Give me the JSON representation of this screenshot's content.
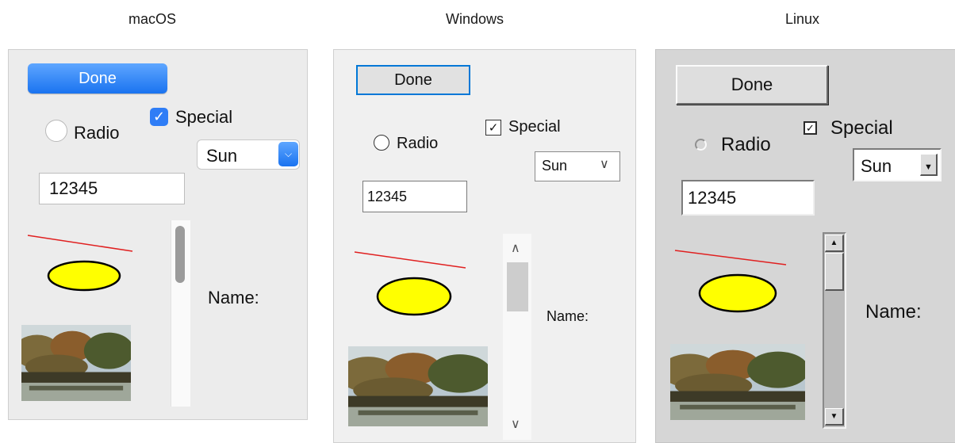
{
  "headings": {
    "mac": "macOS",
    "win": "Windows",
    "lin": "Linux"
  },
  "widgets": {
    "button_label": "Done",
    "radio_label": "Radio",
    "checkbox_label": "Special",
    "checkbox_checked": true,
    "select_value": "Sun",
    "text_value": "12345",
    "name_label": "Name:"
  },
  "icons": {
    "mac_check": "checkmark-icon",
    "mac_select": "chevron-down-icon",
    "win_select": "chevron-down-icon",
    "win_scroll_up": "chevron-up-icon",
    "win_scroll_down": "chevron-down-icon",
    "lin_select": "arrow-down-icon",
    "lin_scroll_up": "arrow-up-icon",
    "lin_scroll_down": "arrow-down-icon"
  },
  "colors": {
    "mac_accent": "#2f7df6",
    "win_focus": "#0078d7",
    "ellipse_fill": "#ffff00",
    "line_stroke": "#e02020"
  }
}
